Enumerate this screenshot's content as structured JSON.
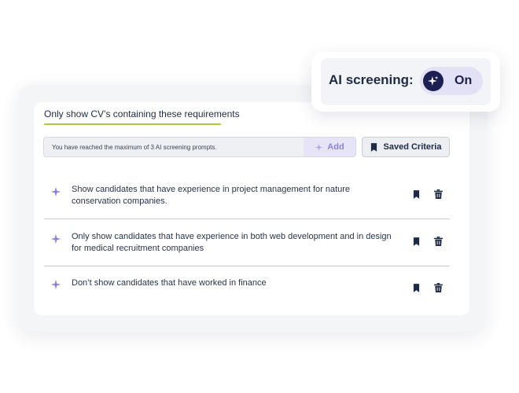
{
  "ai_screening": {
    "label": "AI screening:",
    "toggle_state": "On",
    "toggle_icon": "sparkle-icon"
  },
  "tabs": [
    {
      "label": "Only show CV’s containing these requirements",
      "active": true
    }
  ],
  "prompt_input": {
    "value": "You have reached the maximum of 3 AI screening prompts.",
    "add_label": "Add",
    "add_icon": "sparkle-icon"
  },
  "saved_criteria": {
    "label": "Saved Criteria",
    "icon": "bookmark-icon"
  },
  "criteria": [
    {
      "text": "Show candidates that have experience in project management for nature conservation companies."
    },
    {
      "text": "Only show candidates that have experience in both web development and in design for medical recruitment companies"
    },
    {
      "text": "Don’t show candidates that have worked in finance"
    }
  ],
  "colors": {
    "accent_purple": "#8b7fe0",
    "navy": "#1f2a44",
    "tab_underline": "#a8c93a"
  }
}
